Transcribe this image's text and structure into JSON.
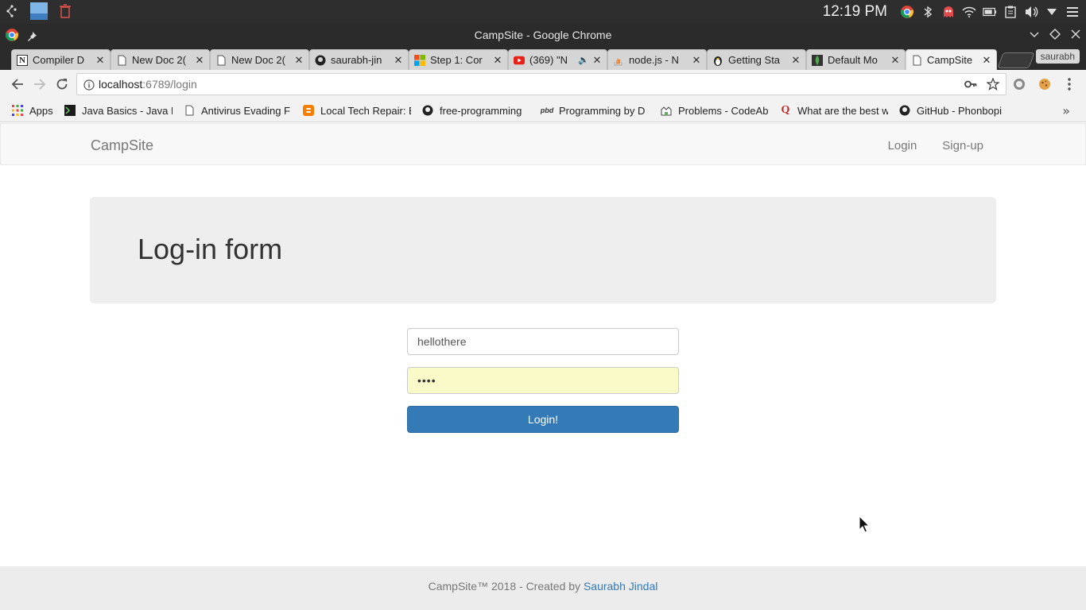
{
  "os": {
    "clock": "12:19 PM"
  },
  "window": {
    "title": "CampSite - Google Chrome"
  },
  "tabs": [
    {
      "label": "Compiler D",
      "icon": "notion-icon"
    },
    {
      "label": "New Doc 2(",
      "icon": "doc-icon"
    },
    {
      "label": "New Doc 2(",
      "icon": "doc-icon"
    },
    {
      "label": "saurabh-jin",
      "icon": "github-icon"
    },
    {
      "label": "Step 1: Cor",
      "icon": "microsoft-icon"
    },
    {
      "label": "(369) \"N",
      "icon": "youtube-icon"
    },
    {
      "label": "node.js - N",
      "icon": "stackoverflow-icon"
    },
    {
      "label": "Getting Sta",
      "icon": "tux-icon"
    },
    {
      "label": "Default Mo",
      "icon": "mongodb-icon"
    },
    {
      "label": "CampSite",
      "icon": "doc-icon",
      "active": true
    }
  ],
  "profile": {
    "name": "saurabh"
  },
  "omnibox": {
    "host": "localhost",
    "path": ":6789/login"
  },
  "bookmarks": [
    {
      "label": "Apps",
      "icon": "apps-grid-icon"
    },
    {
      "label": "Java Basics - Java Pr",
      "icon": "terminal-icon"
    },
    {
      "label": "Antivirus Evading F",
      "icon": "doc-icon"
    },
    {
      "label": "Local Tech Repair: E",
      "icon": "blogger-icon"
    },
    {
      "label": "free-programming",
      "icon": "github-icon"
    },
    {
      "label": "Programming by D",
      "icon": "pbd-icon"
    },
    {
      "label": "Problems - CodeAb",
      "icon": "codeabbey-icon"
    },
    {
      "label": "What are the best w",
      "icon": "quora-icon"
    },
    {
      "label": "GitHub - Phonbopi",
      "icon": "github-icon"
    }
  ],
  "site": {
    "brand": "CampSite",
    "nav": {
      "login": "Login",
      "signup": "Sign-up"
    },
    "heading": "Log-in form",
    "form": {
      "username_value": "hellothere",
      "password_mask": "••••",
      "submit_label": "Login!"
    },
    "footer": {
      "text": "CampSite™ 2018 - Created by ",
      "author": "Saurabh Jindal"
    }
  },
  "colors": {
    "primary": "#337ab7",
    "autofill": "#fafac8",
    "jumbotron": "#eeeeee",
    "navbar": "#f8f8f8"
  }
}
